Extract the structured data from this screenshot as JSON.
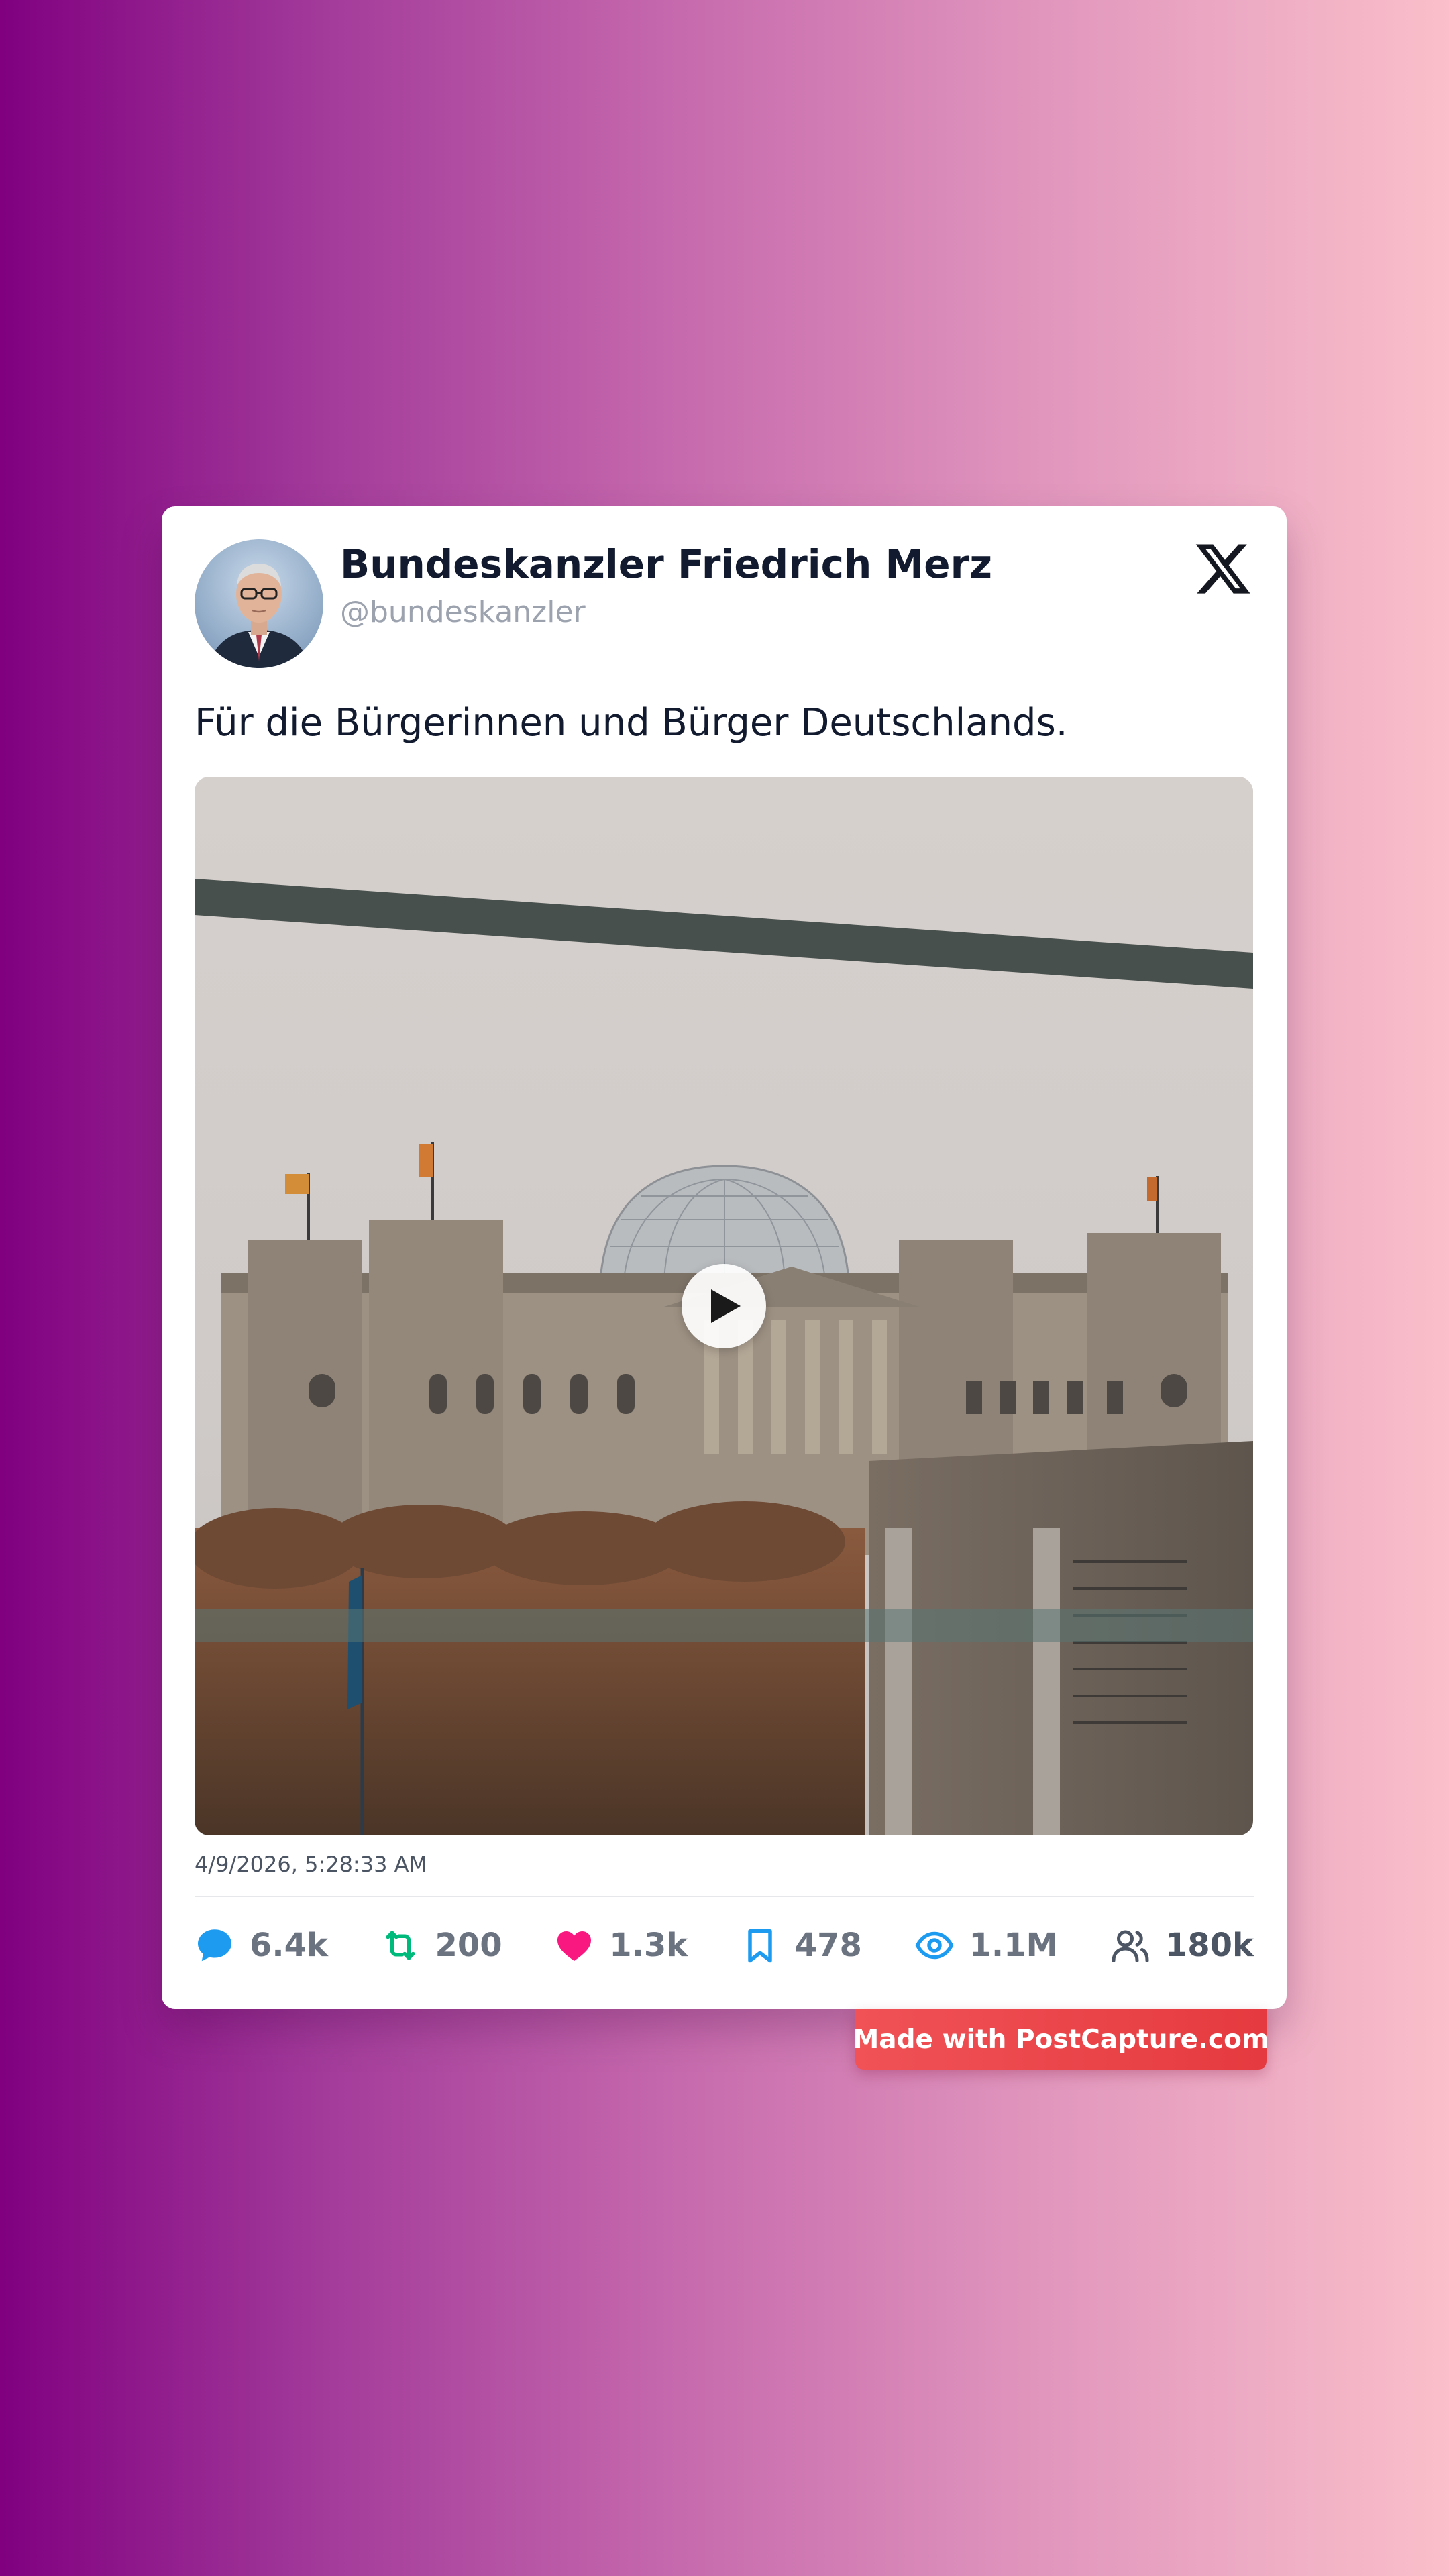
{
  "tweet": {
    "author_name": "Bundeskanzler Friedrich Merz",
    "author_handle": "@bundeskanzler",
    "text": "Für die Bürgerinnen und Bürger Deutschlands.",
    "timestamp": "4/9/2026, 5:28:33 AM",
    "platform_icon": "x-logo-icon",
    "media": {
      "type": "video",
      "play_icon": "play-icon"
    }
  },
  "stats": [
    {
      "icon": "reply-icon",
      "value": "6.4k",
      "color": "#1d9bf0"
    },
    {
      "icon": "retweet-icon",
      "value": "200",
      "color": "#00ba7c"
    },
    {
      "icon": "heart-icon",
      "value": "1.3k",
      "color": "#f91880"
    },
    {
      "icon": "bookmark-icon",
      "value": "478",
      "color": "#1d9bf0"
    },
    {
      "icon": "views-icon",
      "value": "1.1M",
      "color": "#1d9bf0"
    },
    {
      "icon": "followers-icon",
      "value": "180k",
      "color": "#4b5563"
    }
  ],
  "stat_text_color": "#6b7280",
  "watermark": {
    "text": "Made with PostCapture.com",
    "color": "#ef4444"
  }
}
